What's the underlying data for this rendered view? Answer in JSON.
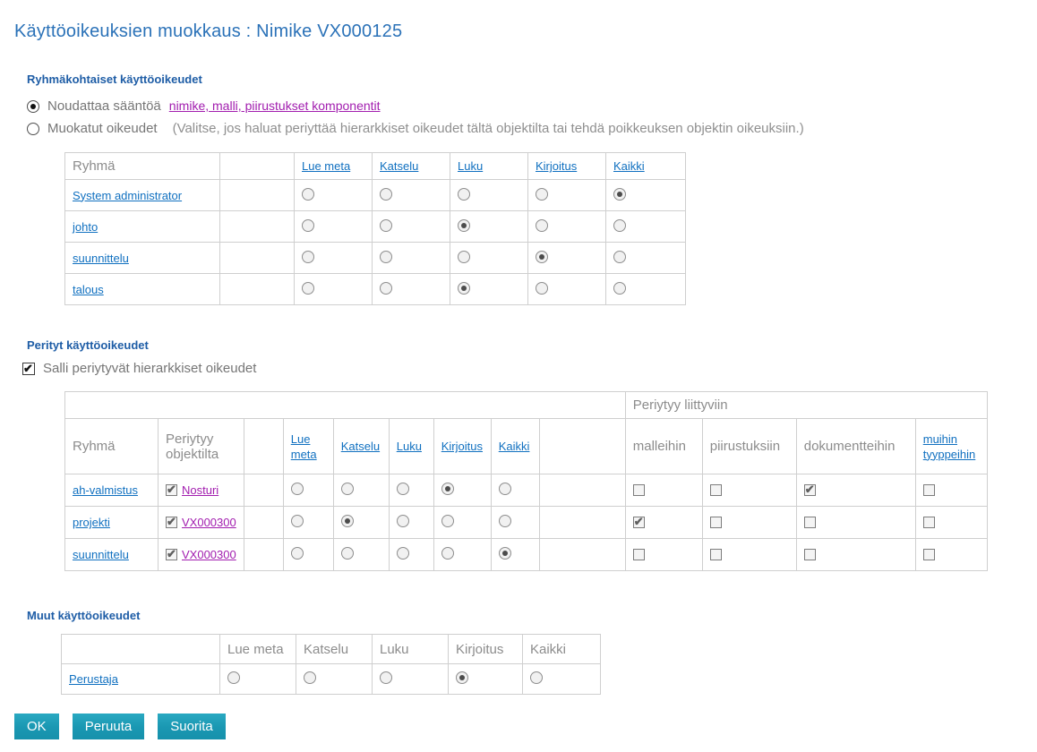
{
  "page": {
    "title": "Käyttöoikeuksien muokkaus : Nimike VX000125"
  },
  "colors": {
    "title_blue": "#2b72b8",
    "heading_blue": "#1e5da6",
    "link_blue": "#1070c0",
    "link_purple": "#a21daf",
    "button_teal": "#1a97b2"
  },
  "group_section": {
    "heading": "Ryhmäkohtaiset käyttöoikeudet",
    "follow_rule": {
      "label": "Noudattaa sääntöä",
      "link": "nimike, malli, piirustukset komponentit",
      "selected": true
    },
    "custom_rights": {
      "label": "Muokatut oikeudet",
      "note": "(Valitse, jos haluat periyttää hierarkkiset oikeudet tältä objektilta tai tehdä poikkeuksen objektin oikeuksiin.)",
      "selected": false
    },
    "table": {
      "group_header": "Ryhmä",
      "perm_headers": [
        "Lue meta",
        "Katselu",
        "Luku",
        "Kirjoitus",
        "Kaikki"
      ],
      "rows": [
        {
          "group": "System administrator",
          "selected": "Kaikki",
          "selected_index": 4
        },
        {
          "group": "johto",
          "selected": "Luku",
          "selected_index": 2
        },
        {
          "group": "suunnittelu",
          "selected": "Kirjoitus",
          "selected_index": 3
        },
        {
          "group": "talous",
          "selected": "Luku",
          "selected_index": 2
        }
      ]
    }
  },
  "inherited_section": {
    "heading": "Perityt käyttöoikeudet",
    "allow_checkbox": {
      "label": "Salli periytyvät hierarkkiset oikeudet",
      "checked": true
    },
    "table": {
      "related_group_header": "Periytyy liittyviin",
      "group_header": "Ryhmä",
      "inherits_from_header": "Periytyy objektilta",
      "perm_headers": [
        "Lue meta",
        "Katselu",
        "Luku",
        "Kirjoitus",
        "Kaikki"
      ],
      "related_headers": [
        "malleihin",
        "piirustuksiin",
        "dokumentteihin",
        "muihin tyyppeihin"
      ],
      "rows": [
        {
          "group": "ah-valmistus",
          "inherits_from": "Nosturi",
          "inherits_checked": true,
          "selected": "Kirjoitus",
          "selected_index": 3,
          "related_checked": [
            false,
            false,
            true,
            false
          ]
        },
        {
          "group": "projekti",
          "inherits_from": "VX000300",
          "inherits_checked": true,
          "selected": "Katselu",
          "selected_index": 1,
          "related_checked": [
            true,
            false,
            false,
            false
          ]
        },
        {
          "group": "suunnittelu",
          "inherits_from": "VX000300",
          "inherits_checked": true,
          "selected": "Kaikki",
          "selected_index": 4,
          "related_checked": [
            false,
            false,
            false,
            false
          ]
        }
      ]
    }
  },
  "other_section": {
    "heading": "Muut käyttöoikeudet",
    "table": {
      "perm_headers": [
        "Lue meta",
        "Katselu",
        "Luku",
        "Kirjoitus",
        "Kaikki"
      ],
      "rows": [
        {
          "group": "Perustaja",
          "selected": "Kirjoitus",
          "selected_index": 3
        }
      ]
    }
  },
  "buttons": {
    "ok": "OK",
    "cancel": "Peruuta",
    "execute": "Suorita"
  }
}
